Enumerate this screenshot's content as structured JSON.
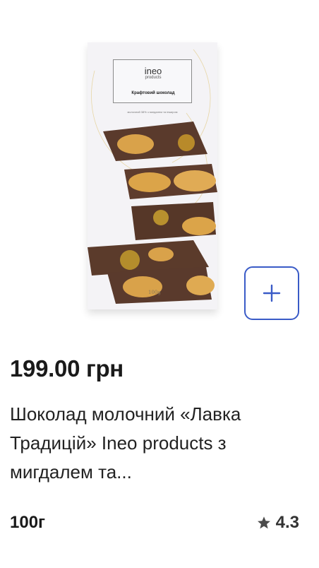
{
  "product": {
    "image": {
      "brand": "ineo",
      "brand_sub": "products",
      "pack_title": "Крафтовий шоколад",
      "pack_desc": "молочний 38% з мигдалем та інжиром",
      "pack_weight": "100g"
    },
    "add_button_icon": "plus-icon",
    "price": "199.00 грн",
    "name": "Шоколад молочний «Лавка Традицій» Ineo products з мигдалем та...",
    "weight": "100г",
    "rating_icon": "star-icon",
    "rating": "4.3"
  },
  "colors": {
    "accent": "#3a5bc7",
    "text": "#1a1a1a",
    "chocolate": "#5a3a2c",
    "almond": "#d9a24a"
  }
}
